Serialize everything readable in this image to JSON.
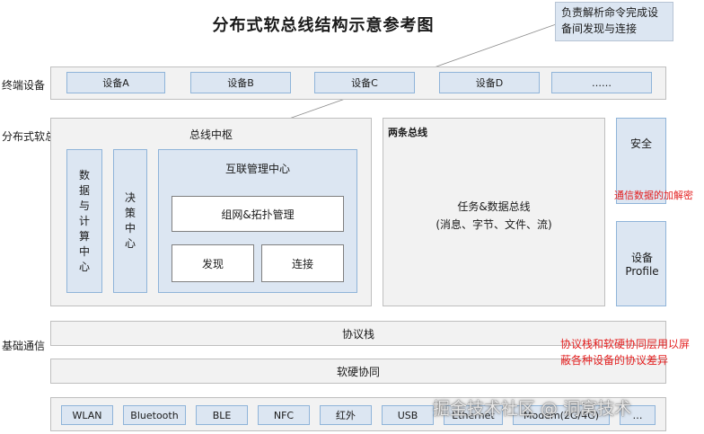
{
  "title": "分布式软总线结构示意参考图",
  "callout": "负责解析命令完成设备间发现与连接",
  "terminal": {
    "label": "终端设备",
    "devices": [
      "设备A",
      "设备B",
      "设备C",
      "设备D",
      "……"
    ]
  },
  "softbus": {
    "label": "分布式软总线",
    "hub": {
      "title": "总线中枢",
      "data_center": "数\n据\n与\n计\n算\n中\n心",
      "decision_center": "决\n策\n中\n心",
      "interconnect": {
        "title": "互联管理中心",
        "topology": "组网&拓扑管理",
        "discover": "发现",
        "connect": "连接"
      }
    },
    "two_buses": {
      "title": "两条总线",
      "task_bus": "任务&数据总线",
      "task_bus_detail": "(消息、字节、文件、流)"
    },
    "security": "安全",
    "security_note": "通信数据的加解密",
    "profile_line1": "设备",
    "profile_line2": "Profile"
  },
  "basic": {
    "label": "基础通信",
    "protocol_stack": "协议栈",
    "hw_sw": "软硬协同",
    "note": "协议栈和软硬协同层用以屏蔽各种设备的协议差异"
  },
  "protocols": [
    "WLAN",
    "Bluetooth",
    "BLE",
    "NFC",
    "红外",
    "USB",
    "Ethernet",
    "Modem(2G/4G)",
    "…"
  ],
  "watermark": "掘金技术社区 @ 洞窝技术",
  "colors": {
    "panel_blue": "#dce6f2",
    "border_blue": "#8fb4d9",
    "band_gray": "#f2f2f2",
    "note_red": "#e31f1f"
  }
}
